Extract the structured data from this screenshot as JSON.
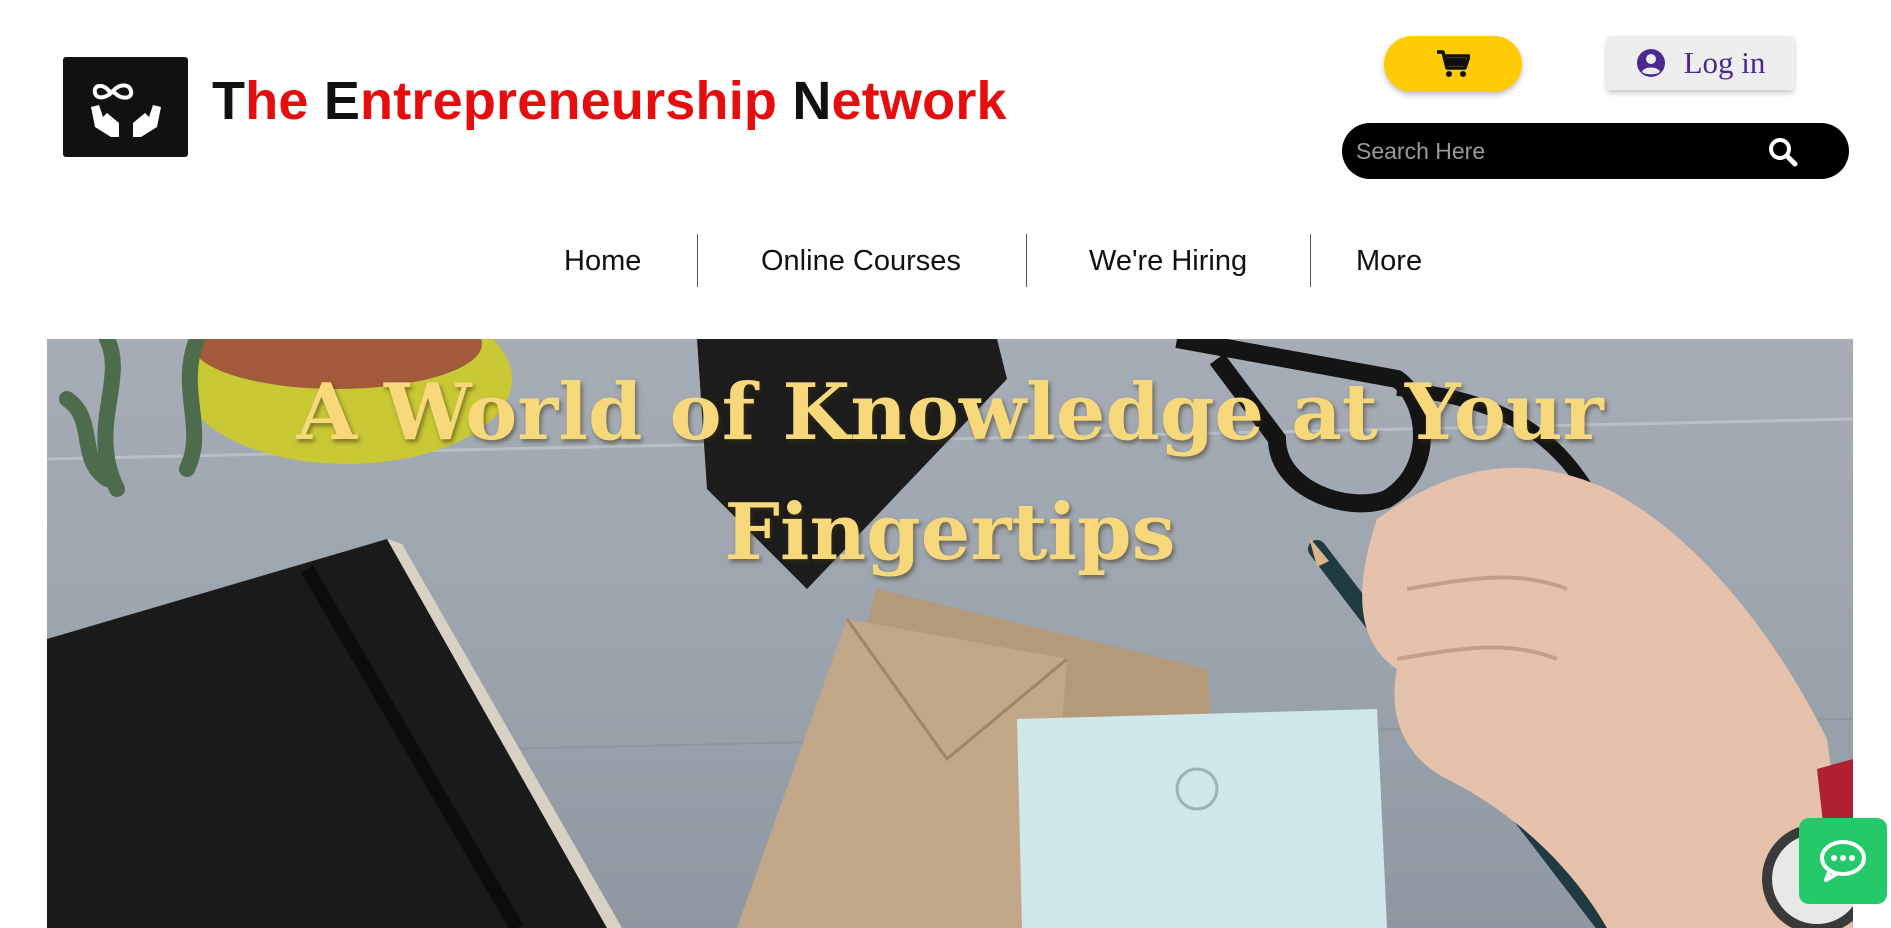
{
  "header": {
    "brand": {
      "segments": [
        {
          "text": "T",
          "color": "#111111"
        },
        {
          "text": "he ",
          "color": "#e50d0d"
        },
        {
          "text": "E",
          "color": "#111111"
        },
        {
          "text": "ntrepreneurship ",
          "color": "#e50d0d"
        },
        {
          "text": "N",
          "color": "#111111"
        },
        {
          "text": "etwork",
          "color": "#e50d0d"
        }
      ]
    },
    "logo_icon": "hands-infinity-icon",
    "cart_icon": "cart-icon",
    "login_label": "Log in",
    "login_icon": "user-circle-icon",
    "search": {
      "placeholder": "Search Here",
      "value": "",
      "icon": "search-icon"
    }
  },
  "nav": {
    "items": [
      {
        "label": "Home"
      },
      {
        "label": "Online Courses"
      },
      {
        "label": "We're Hiring"
      },
      {
        "label": "More"
      }
    ]
  },
  "hero": {
    "title_line1": "A World of Knowledge at Your",
    "title_line2": "Fingertips"
  },
  "chat": {
    "icon": "chat-bubble-icon"
  },
  "colors": {
    "accent_yellow": "#ffcb05",
    "brand_red": "#e50d0d",
    "hero_title": "#f7d97c",
    "chat_green": "#25c96a",
    "login_purple": "#4b2a8f"
  }
}
